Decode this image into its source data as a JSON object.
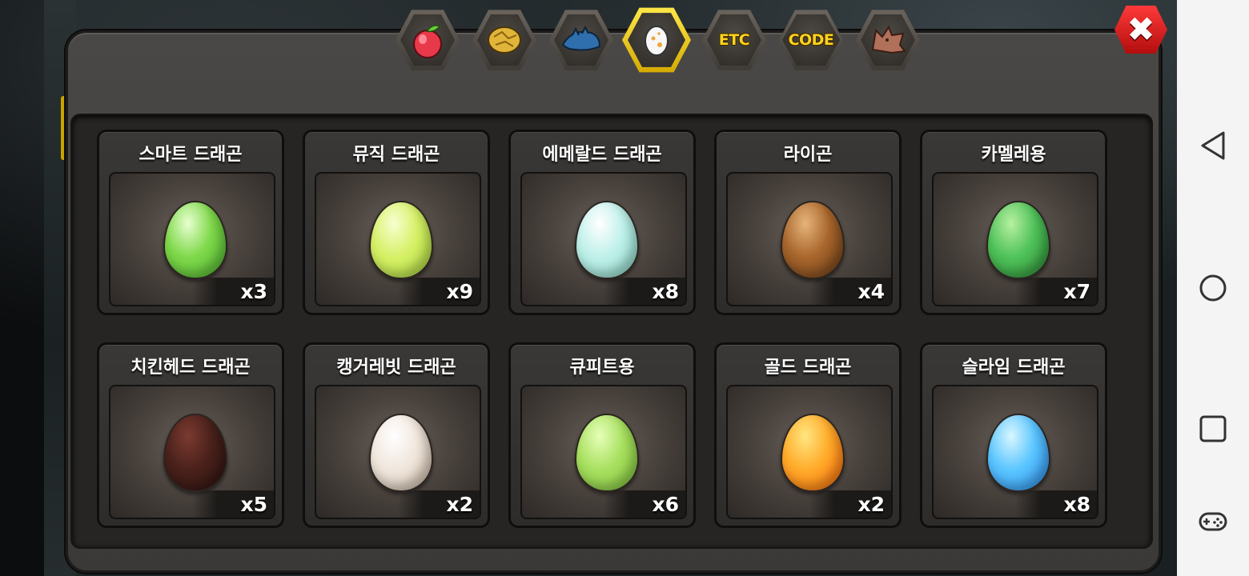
{
  "tabs": [
    {
      "name": "fruit-tab",
      "icon": "fruit-icon",
      "active": false
    },
    {
      "name": "gold-rock-tab",
      "icon": "gold-rock-icon",
      "active": false
    },
    {
      "name": "dragon-tab",
      "icon": "dragon-icon",
      "active": false
    },
    {
      "name": "egg-tab",
      "icon": "egg-icon",
      "active": true
    },
    {
      "name": "etc-tab",
      "label": "ETC",
      "active": false
    },
    {
      "name": "code-tab",
      "label": "CODE",
      "active": false
    },
    {
      "name": "wolf-tab",
      "icon": "wolf-icon",
      "active": false
    }
  ],
  "close_icon": "close-icon",
  "eggs": [
    {
      "name": "스마트 드래곤",
      "count": "x3",
      "colors": [
        "#e7ffd0",
        "#7fd84a",
        "#4db82f"
      ]
    },
    {
      "name": "뮤직 드래곤",
      "count": "x9",
      "colors": [
        "#f7ffd0",
        "#d6f066",
        "#a8d83a"
      ]
    },
    {
      "name": "에메랄드 드래곤",
      "count": "x8",
      "colors": [
        "#ffffff",
        "#bff0ea",
        "#86d6c4"
      ]
    },
    {
      "name": "라이곤",
      "count": "x4",
      "colors": [
        "#e6b47a",
        "#a8662c",
        "#6e3f17"
      ]
    },
    {
      "name": "카멜레용",
      "count": "x7",
      "colors": [
        "#b7f0a0",
        "#4fc25a",
        "#2c8a34"
      ]
    },
    {
      "name": "치킨헤드 드래곤",
      "count": "x5",
      "colors": [
        "#7a3a30",
        "#4a211b",
        "#2c1310"
      ]
    },
    {
      "name": "캥거레빗 드래곤",
      "count": "x2",
      "colors": [
        "#ffffff",
        "#f0e6dc",
        "#c9b6a2"
      ]
    },
    {
      "name": "큐피트용",
      "count": "x6",
      "colors": [
        "#e6ffb8",
        "#a8e060",
        "#7fc63a"
      ]
    },
    {
      "name": "골드 드래곤",
      "count": "x2",
      "colors": [
        "#ffe680",
        "#ffab2a",
        "#ff6a0a"
      ]
    },
    {
      "name": "슬라임 드래곤",
      "count": "x8",
      "colors": [
        "#d8f6ff",
        "#5bc6ff",
        "#2a8cf0"
      ]
    }
  ],
  "nav": {
    "back": "back-icon",
    "home": "home-icon",
    "recents": "recents-icon",
    "game": "gamepad-icon"
  }
}
